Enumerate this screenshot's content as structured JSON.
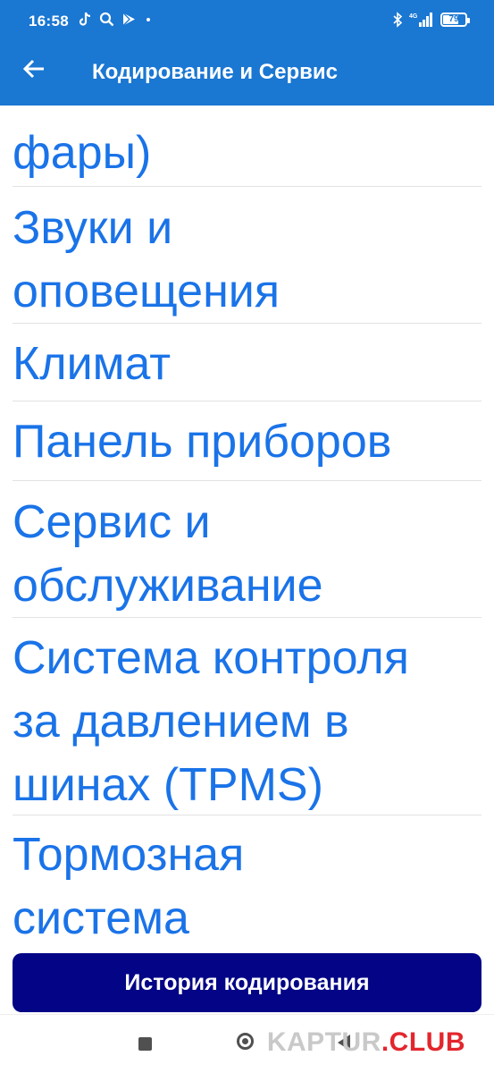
{
  "status_bar": {
    "time": "16:58",
    "left_icons": [
      "tiktok-icon",
      "search-icon",
      "play-store-icon",
      "dot-icon"
    ],
    "right_icons": [
      "bluetooth-icon",
      "signal-4g-icon"
    ],
    "network_label": "4G",
    "battery_level": "79"
  },
  "app_bar": {
    "title": "Кодирование и Сервис",
    "back_icon": "arrow-back-icon",
    "color": "#1a77d2"
  },
  "list": {
    "text_color": "#1a73e8",
    "items": [
      {
        "lines": [
          "фары)"
        ]
      },
      {
        "lines": [
          "Звуки и",
          "оповещения"
        ]
      },
      {
        "lines": [
          "Климат"
        ]
      },
      {
        "lines": [
          "Панель приборов"
        ]
      },
      {
        "lines": [
          "Сервис и",
          "обслуживание"
        ]
      },
      {
        "lines": [
          "Система контроля",
          "за давлением в",
          "шинах (TPMS)"
        ]
      },
      {
        "lines": [
          "Тормозная",
          "система"
        ]
      }
    ]
  },
  "history_button": {
    "label": "История кодирования",
    "color": "#030586"
  },
  "nav_bar": {
    "icons": [
      "recents-square-icon",
      "home-circle-icon",
      "back-triangle-icon"
    ]
  },
  "watermark": {
    "main": "KAPTUR",
    "accent": ".CLUB"
  }
}
